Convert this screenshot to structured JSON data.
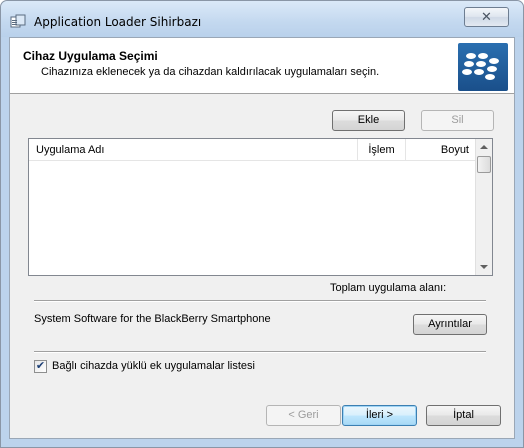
{
  "window": {
    "title": "Application Loader Sihirbazı",
    "close_glyph": "✕",
    "icon": "app-window-icon"
  },
  "header": {
    "title": "Cihaz Uygulama Seçimi",
    "subtitle": "Cihazınıza eklenecek ya da cihazdan kaldırılacak uygulamaları seçin.",
    "logo": "blackberry-logo"
  },
  "toolbar": {
    "add_label": "Ekle",
    "delete_label": "Sil"
  },
  "app_list": {
    "columns": [
      "Uygulama Adı",
      "İşlem",
      "Boyut"
    ],
    "rows": []
  },
  "summary": {
    "total_label": "Toplam uygulama alanı:"
  },
  "system_software": {
    "label": "System Software for the BlackBerry Smartphone",
    "details_label": "Ayrıntılar"
  },
  "options": {
    "list_apps_label": "Bağlı cihazda yüklü ek uygulamalar listesi",
    "list_apps_checked": true,
    "check_glyph": "✔"
  },
  "nav": {
    "back_label": "< Geri",
    "next_label": "İleri >",
    "cancel_label": "İptal"
  },
  "colors": {
    "accent": "#3c7fb1",
    "logo_bg": "#1f5a9c"
  }
}
